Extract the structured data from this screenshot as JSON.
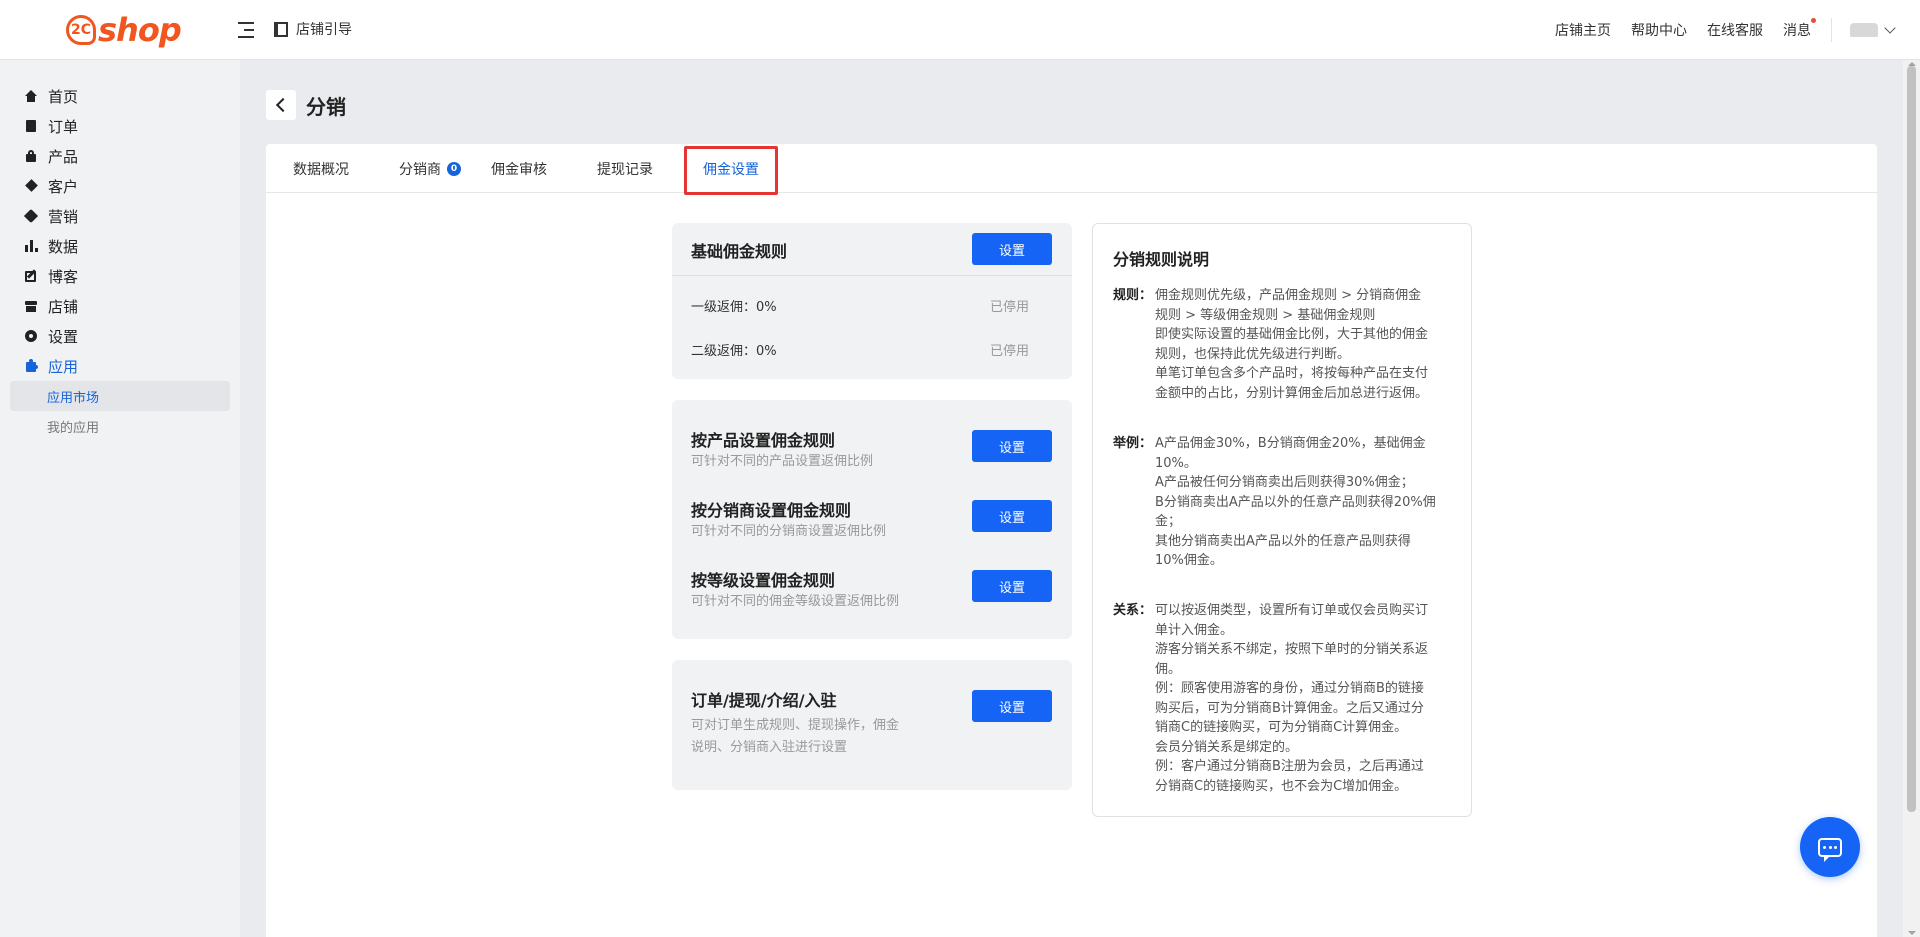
{
  "header": {
    "logo_badge": "2C",
    "logo_text": "shop",
    "guide": "店铺引导",
    "links": [
      "店铺主页",
      "帮助中心",
      "在线客服",
      "消息"
    ]
  },
  "sidebar": {
    "items": [
      {
        "label": "首页",
        "icon": "home-icon"
      },
      {
        "label": "订单",
        "icon": "clipboard-icon"
      },
      {
        "label": "产品",
        "icon": "bag-icon"
      },
      {
        "label": "客户",
        "icon": "diamond-icon"
      },
      {
        "label": "营销",
        "icon": "tag-icon"
      },
      {
        "label": "数据",
        "icon": "bar-chart-icon"
      },
      {
        "label": "博客",
        "icon": "edit-icon"
      },
      {
        "label": "店铺",
        "icon": "store-icon"
      },
      {
        "label": "设置",
        "icon": "gear-icon"
      },
      {
        "label": "应用",
        "icon": "puzzle-icon"
      }
    ],
    "sub_items": [
      "应用市场",
      "我的应用"
    ]
  },
  "page": {
    "title": "分销",
    "tabs": [
      "数据概况",
      "分销商",
      "佣金审核",
      "提现记录",
      "佣金设置"
    ],
    "badge": "0"
  },
  "basic": {
    "title": "基础佣金规则",
    "button": "设置",
    "rows": [
      {
        "label": "一级返佣：0%",
        "status": "已停用"
      },
      {
        "label": "二级返佣：0%",
        "status": "已停用"
      }
    ]
  },
  "custom_rules": [
    {
      "title": "按产品设置佣金规则",
      "desc": "可针对不同的产品设置返佣比例",
      "button": "设置"
    },
    {
      "title": "按分销商设置佣金规则",
      "desc": "可针对不同的分销商设置返佣比例",
      "button": "设置"
    },
    {
      "title": "按等级设置佣金规则",
      "desc": "可针对不同的佣金等级设置返佣比例",
      "button": "设置"
    }
  ],
  "order": {
    "title": "订单/提现/介绍/入驻",
    "desc_line1": "可对订单生成规则、提现操作，佣金",
    "desc_line2": "说明、分销商入驻进行设置",
    "button": "设置"
  },
  "rules": {
    "title": "分销规则说明",
    "blocks": [
      {
        "label": "规则：",
        "lines": [
          "佣金规则优先级，产品佣金规则 > 分销商佣金",
          "规则 > 等级佣金规则 > 基础佣金规则",
          "即使实际设置的基础佣金比例，大于其他的佣金",
          "规则，也保持此优先级进行判断。",
          "单笔订单包含多个产品时，将按每种产品在支付",
          "金额中的占比，分别计算佣金后加总进行返佣。"
        ]
      },
      {
        "label": "举例：",
        "lines": [
          "A产品佣金30%，B分销商佣金20%，基础佣金",
          "10%。",
          "A产品被任何分销商卖出后则获得30%佣金；",
          "B分销商卖出A产品以外的任意产品则获得20%佣",
          "金；",
          "其他分销商卖出A产品以外的任意产品则获得",
          "10%佣金。"
        ]
      },
      {
        "label": "关系：",
        "lines": [
          "可以按返佣类型，设置所有订单或仅会员购买订",
          "单计入佣金。",
          "游客分销关系不绑定，按照下单时的分销关系返",
          "佣。",
          "例：顾客使用游客的身份，通过分销商B的链接",
          "购买后，可为分销商B计算佣金。之后又通过分",
          "销商C的链接购买，可为分销商C计算佣金。",
          "会员分销关系是绑定的。",
          "例：客户通过分销商B注册为会员，之后再通过",
          "分销商C的链接购买，也不会为C增加佣金。"
        ]
      }
    ]
  },
  "colors": {
    "accent": "#1664f5",
    "brand": "#f0561e",
    "highlight": "#e53434"
  }
}
